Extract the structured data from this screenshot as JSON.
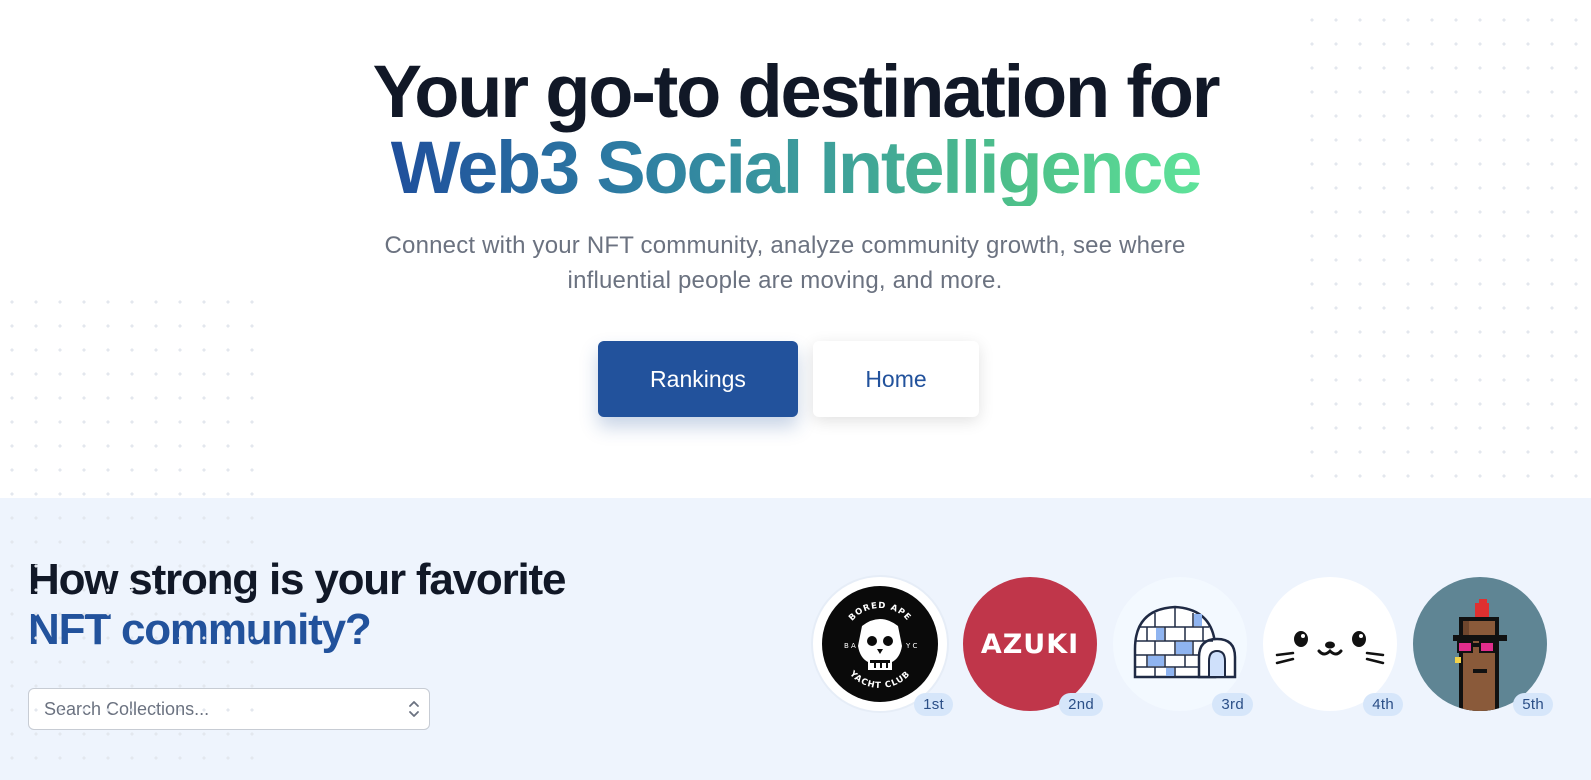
{
  "hero": {
    "title_line1": "Your go-to destination for",
    "title_line2": "Web3 Social Intelligence",
    "subtitle_line1": "Connect with your NFT community, analyze community growth, see where",
    "subtitle_line2": "influential people are moving, and more.",
    "primary_button": "Rankings",
    "secondary_button": "Home"
  },
  "community": {
    "title_line1": "How strong is your favorite",
    "title_line2": "NFT community?",
    "search_placeholder": "Search Collections...",
    "rankings": [
      {
        "rank": "1st",
        "icon": "bored-ape-yacht-club-logo",
        "logo_text": "BORED APE YACHT CLUB",
        "logo_side_text": "BA YC"
      },
      {
        "rank": "2nd",
        "icon": "azuki-logo",
        "logo_text": "AZUKI"
      },
      {
        "rank": "3rd",
        "icon": "igloo-logo"
      },
      {
        "rank": "4th",
        "icon": "seal-face-logo"
      },
      {
        "rank": "5th",
        "icon": "pixel-punk-logo"
      }
    ]
  },
  "colors": {
    "brand_blue": "#22529c",
    "band_background": "#eef4fd",
    "azuki_red": "#c0364a",
    "badge_bg": "#d6e6fa"
  }
}
